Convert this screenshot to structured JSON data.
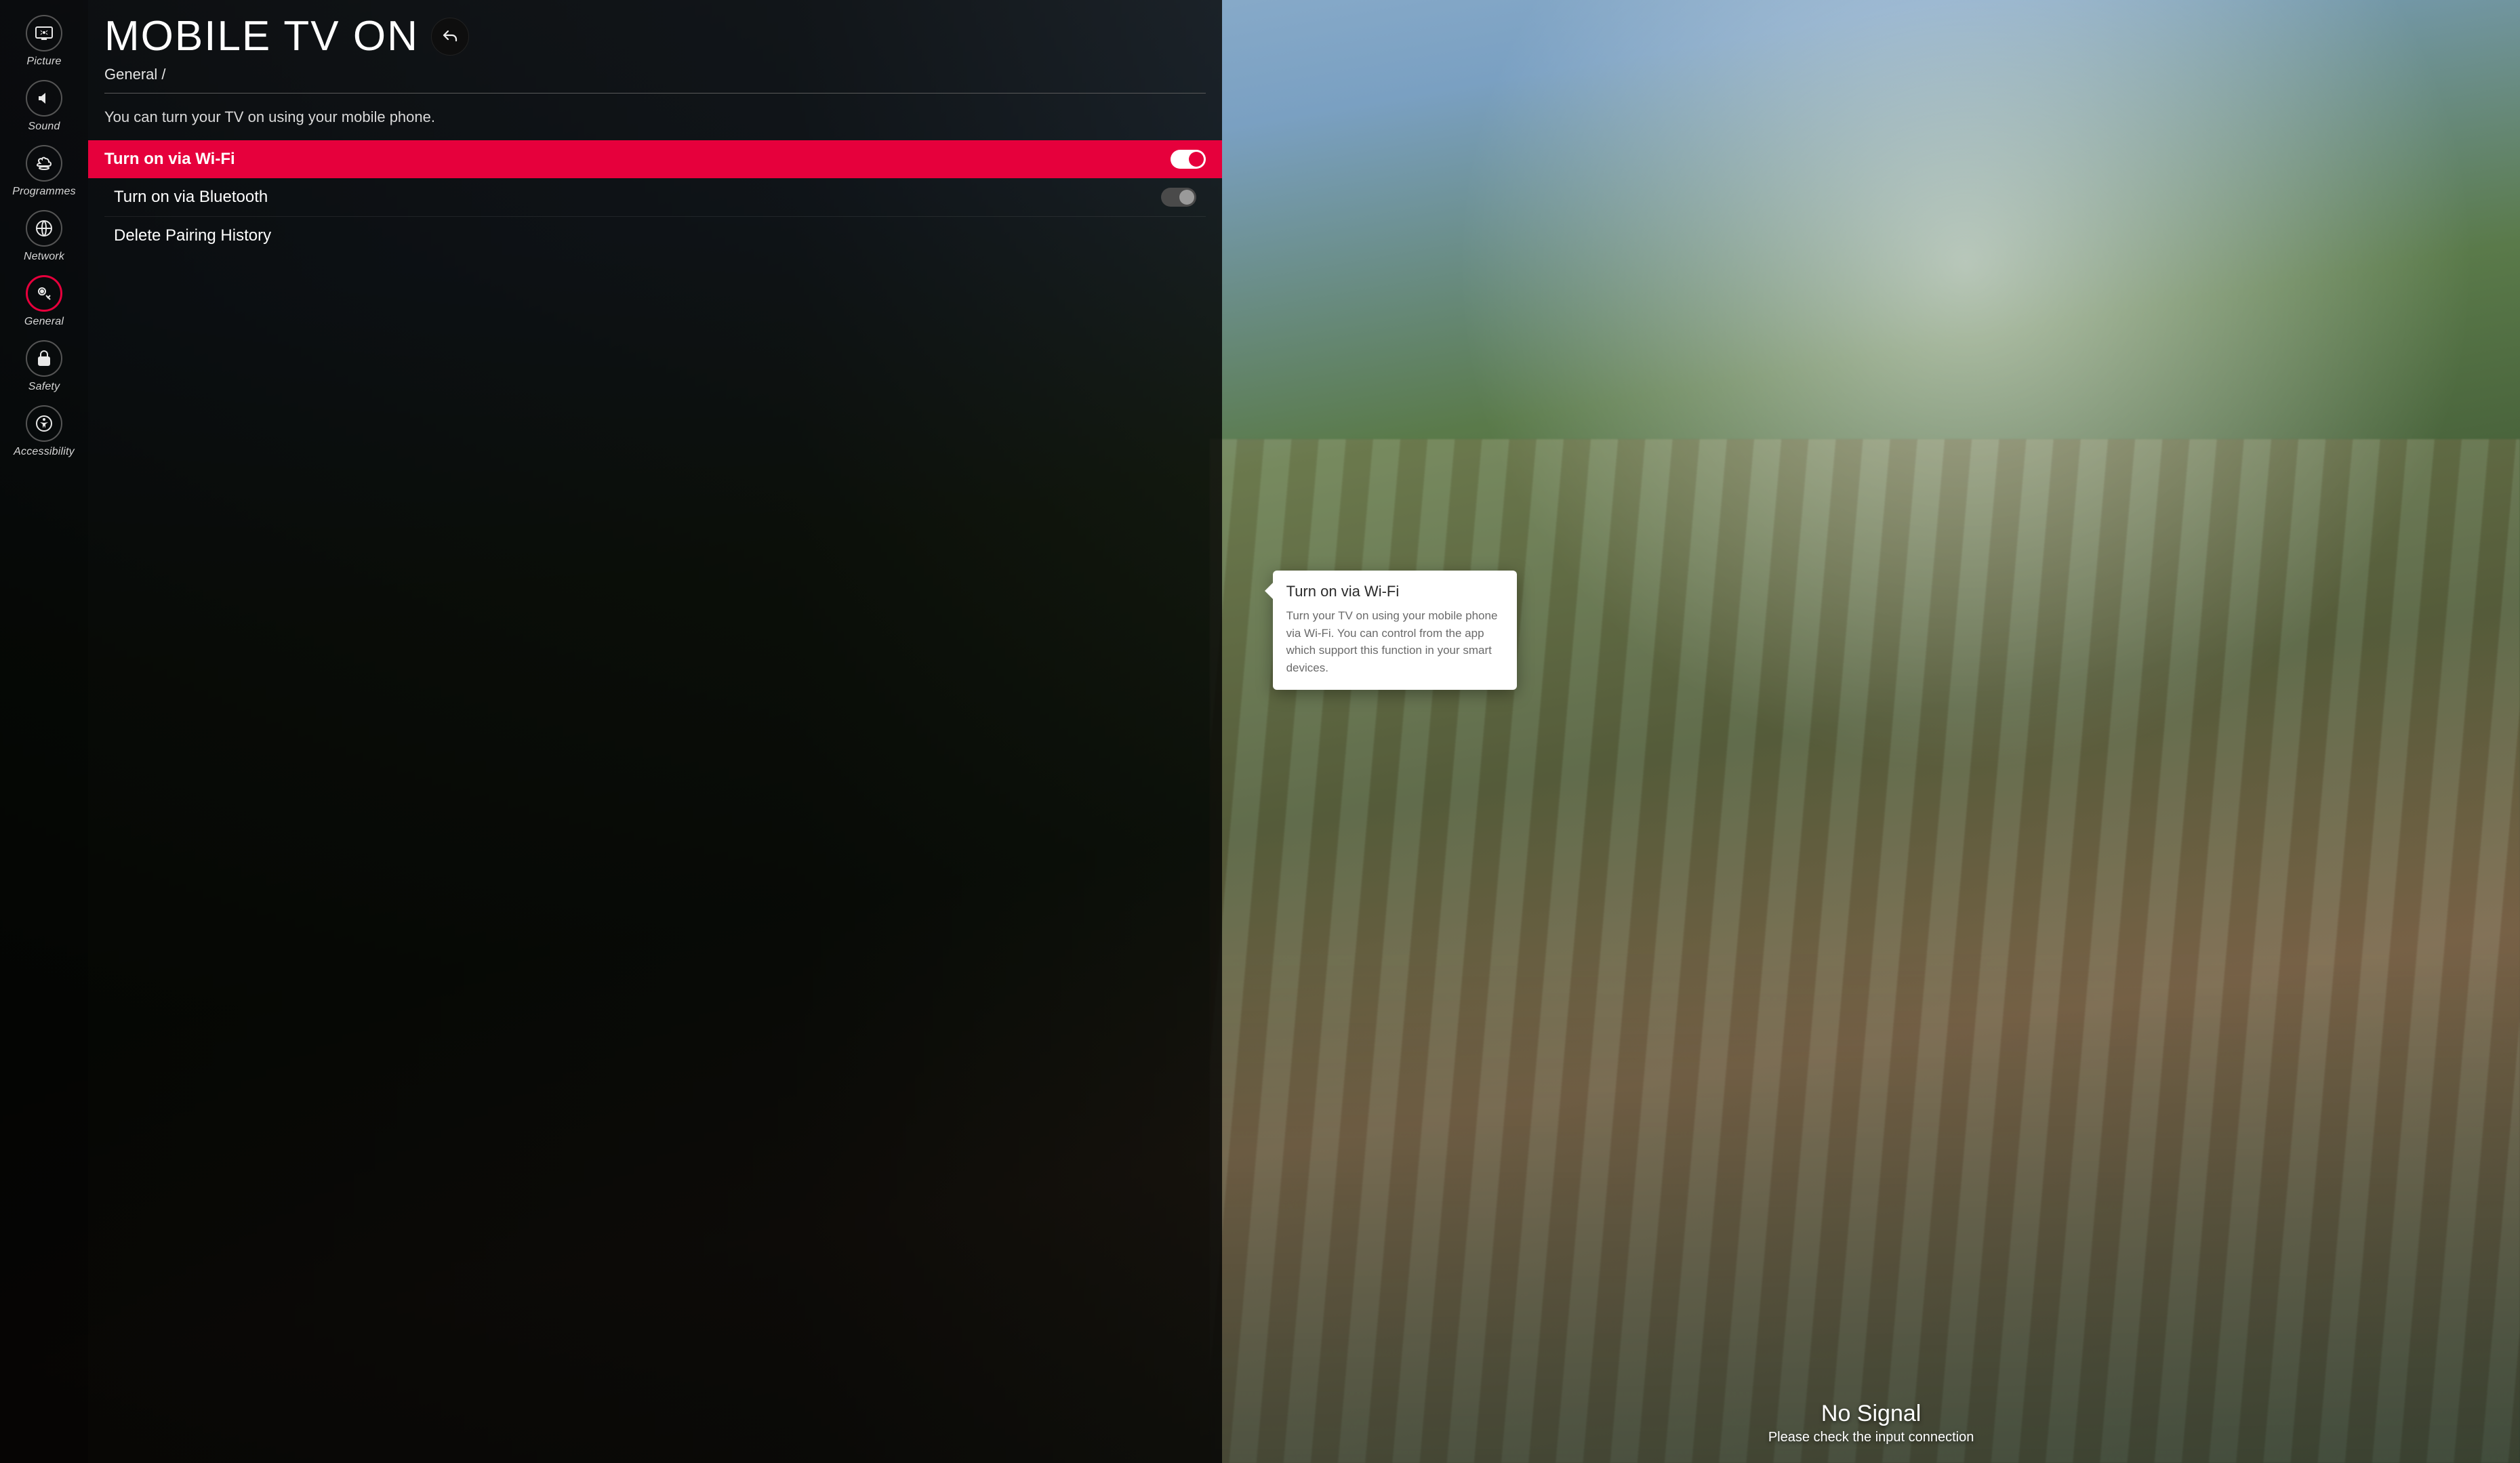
{
  "sidebar": {
    "items": [
      {
        "label": "Picture"
      },
      {
        "label": "Sound"
      },
      {
        "label": "Programmes"
      },
      {
        "label": "Network"
      },
      {
        "label": "General"
      },
      {
        "label": "Safety"
      },
      {
        "label": "Accessibility"
      }
    ],
    "active_index": 4
  },
  "page": {
    "title": "MOBILE TV ON",
    "breadcrumb": "General /",
    "description": "You can turn your TV on using your mobile phone."
  },
  "rows": {
    "wifi": {
      "label": "Turn on via Wi-Fi",
      "on": true,
      "selected": true
    },
    "bluetooth": {
      "label": "Turn on via Bluetooth",
      "on": false,
      "selected": false
    },
    "delete": {
      "label": "Delete Pairing History"
    }
  },
  "tooltip": {
    "title": "Turn on via Wi-Fi",
    "body": "Turn your TV on using your mobile phone via Wi-Fi. You can control from the app which support this function in your smart devices."
  },
  "nosignal": {
    "title": "No Signal",
    "subtitle": "Please check the input connection"
  }
}
